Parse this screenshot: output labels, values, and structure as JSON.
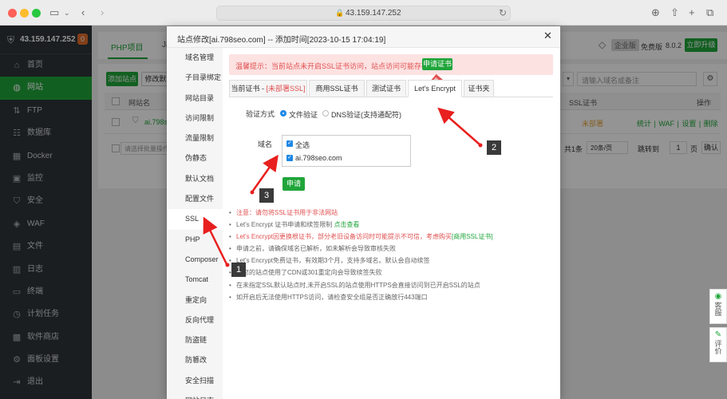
{
  "browser": {
    "url": "43.159.147.252",
    "icons": [
      "sidebar-icon",
      "back-icon",
      "forward-icon",
      "download-icon",
      "share-icon",
      "new-tab-icon",
      "tabs-icon"
    ]
  },
  "sidebar": {
    "server_ip": "43.159.147.252",
    "badge": "0",
    "items": [
      {
        "label": "首页",
        "icon": "home-icon"
      },
      {
        "label": "网站",
        "icon": "globe-icon"
      },
      {
        "label": "FTP",
        "icon": "ftp-icon"
      },
      {
        "label": "数据库",
        "icon": "database-icon"
      },
      {
        "label": "Docker",
        "icon": "docker-icon"
      },
      {
        "label": "监控",
        "icon": "monitor-icon"
      },
      {
        "label": "安全",
        "icon": "shield-icon"
      },
      {
        "label": "WAF",
        "icon": "waf-icon"
      },
      {
        "label": "文件",
        "icon": "folder-icon"
      },
      {
        "label": "日志",
        "icon": "log-icon"
      },
      {
        "label": "终端",
        "icon": "terminal-icon"
      },
      {
        "label": "计划任务",
        "icon": "clock-icon"
      },
      {
        "label": "软件商店",
        "icon": "store-icon"
      },
      {
        "label": "面板设置",
        "icon": "gear-icon"
      },
      {
        "label": "退出",
        "icon": "logout-icon"
      }
    ],
    "active_index": 1
  },
  "main": {
    "tabs": [
      "PHP项目",
      "Ja"
    ],
    "enterprise": "企业版",
    "edition": "免费版",
    "version": "8.0.2",
    "upgrade": "立即升级",
    "add_site": "添加站点",
    "modify": "修改默",
    "search_placeholder": "请输入域名或备注",
    "col_site": "网站名",
    "col_ssl": "SSL证书",
    "col_action": "操作",
    "row_site": "ai.798seo",
    "row_ssl": "未部署",
    "row_actions": "统计 | WAF | 设置 | 删除",
    "batch_placeholder": "请选择批量操作",
    "total": "共1条",
    "per_page": "20条/页",
    "goto": "跳转到",
    "page": "1",
    "page_unit": "页",
    "confirm": "确认"
  },
  "float_tabs": [
    {
      "label": "客服",
      "icon": "chat-icon"
    },
    {
      "label": "评价",
      "icon": "rate-icon"
    }
  ],
  "modal": {
    "title": "站点修改[ai.798seo.com] -- 添加时间[2023-10-15 17:04:19]",
    "close": "✕",
    "nav": [
      "域名管理",
      "子目录绑定",
      "网站目录",
      "访问限制",
      "流量限制",
      "伪静态",
      "默认文档",
      "配置文件",
      "SSL",
      "PHP",
      "Composer",
      "Tomcat",
      "重定向",
      "反向代理",
      "防盗链",
      "防篡改",
      "安全扫描",
      "网站日志"
    ],
    "nav_active": 8,
    "alert_text": "温馨提示：当前站点未开启SSL证书访问，站点访问可能存在风险。",
    "alert_button": "申请证书",
    "ssl_tabs": {
      "current_prefix": "当前证书 - ",
      "current_status": "[未部署SSL]",
      "commercial": "商用SSL证书",
      "ribbon": "推荐",
      "test": "测试证书",
      "letsencrypt": "Let's Encrypt",
      "folder": "证书夹"
    },
    "verify_label": "验证方式",
    "verify_file": "文件验证",
    "verify_dns": "DNS验证(支持通配符)",
    "domain_label": "域名",
    "select_all": "全选",
    "domain_item": "ai.798seo.com",
    "apply_button": "申请",
    "notes": [
      {
        "text": "注意：请勿将SSL证书用于非法网站",
        "style": "red"
      },
      {
        "text": "Let's Encrypt 证书申请和续签限制 ",
        "link": "点击查看",
        "style": "normal"
      },
      {
        "text": "Let's Encrypt因更换根证书，部分老旧设备访问时可能提示不可信，考虑购买",
        "link": "[商用SSL证书]",
        "style": "red"
      },
      {
        "text": "申请之前，请确保域名已解析，如未解析会导致审核失败",
        "style": "normal"
      },
      {
        "text": "Let's Encrypt免费证书，有效期3个月，支持多域名。默认会自动续签",
        "style": "normal"
      },
      {
        "text": "若您的站点使用了CDN或301重定向会导致续签失败",
        "style": "normal"
      },
      {
        "text": "在未指定SSL默认站点时,未开启SSL的站点使用HTTPS会直接访问到已开启SSL的站点",
        "style": "normal"
      },
      {
        "text": "如开启后无法使用HTTPS访问，请检查安全组是否正确放行443端口",
        "style": "normal"
      }
    ]
  },
  "annotations": [
    "1",
    "2",
    "3"
  ],
  "colors": {
    "accent": "#20a53a",
    "danger": "#e05050",
    "annotation": "#e8201f"
  }
}
